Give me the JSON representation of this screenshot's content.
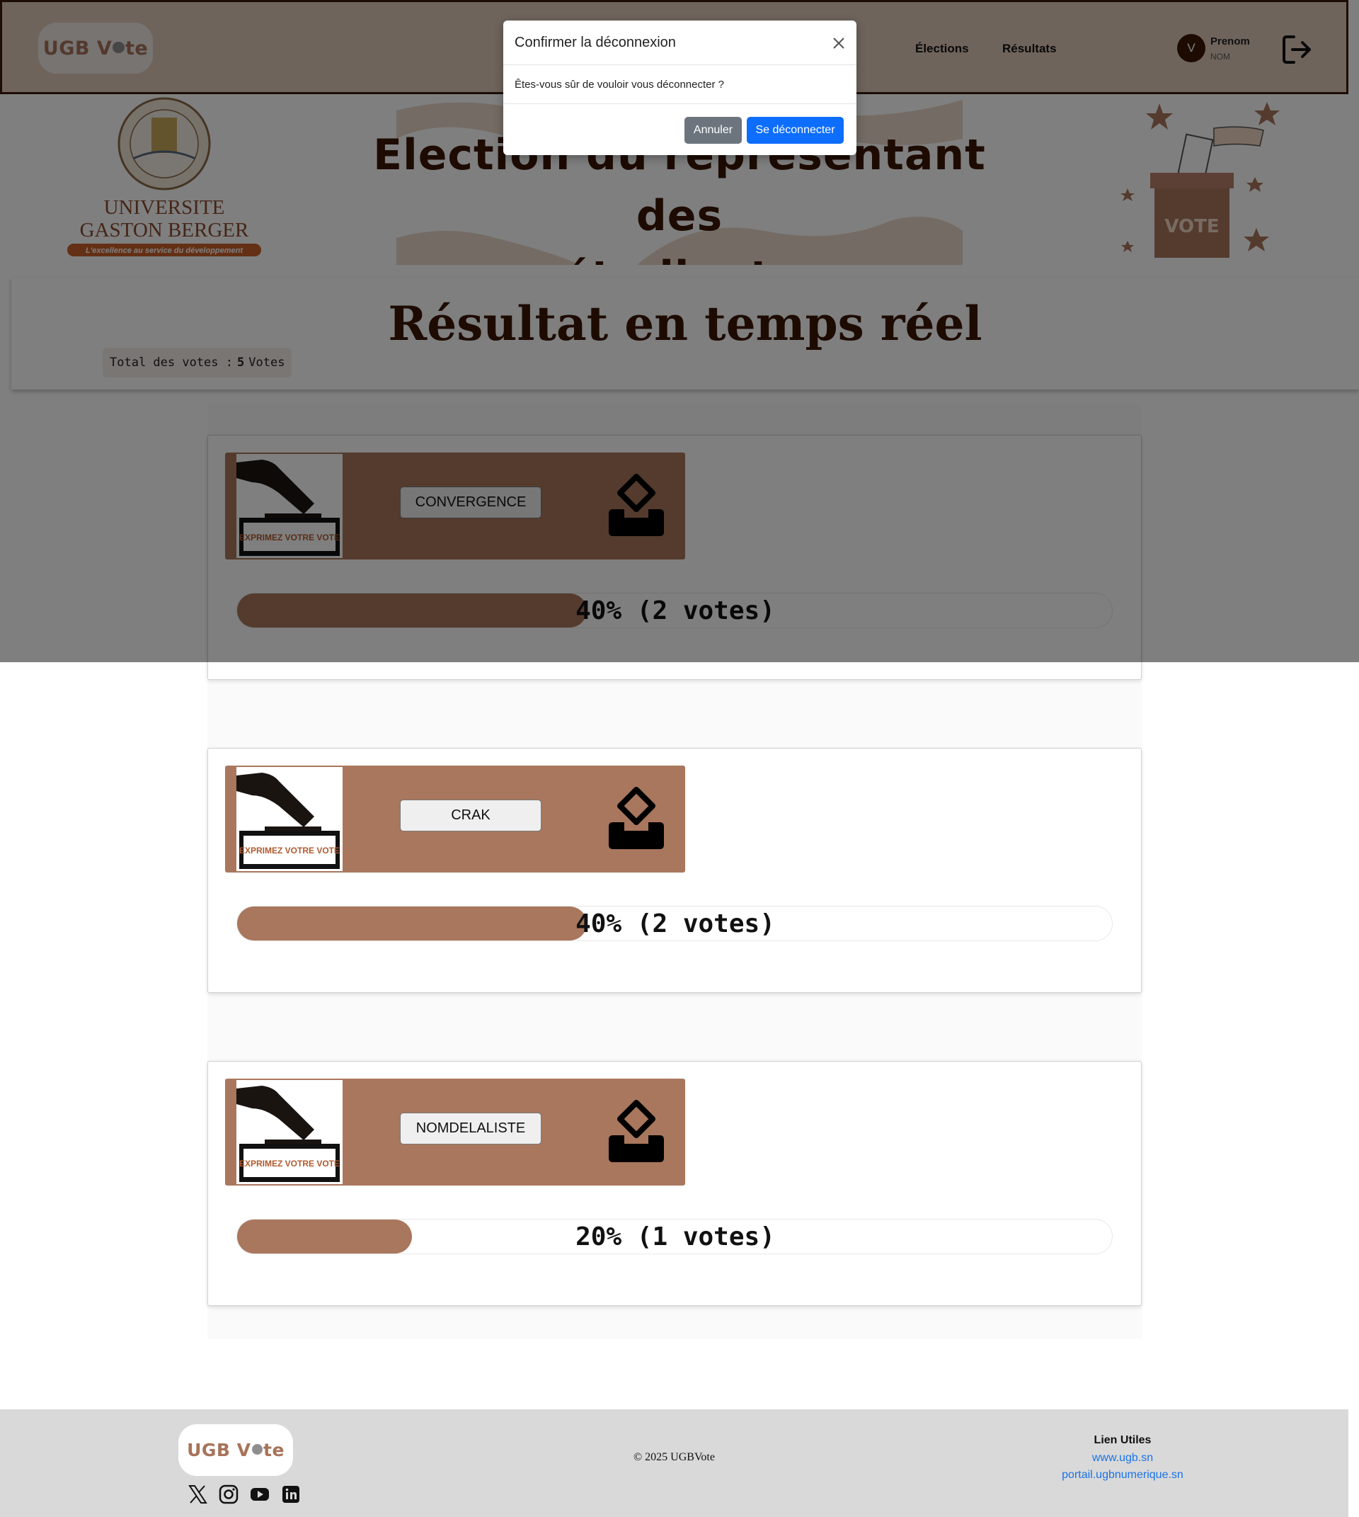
{
  "header": {
    "logo": {
      "text_left": "UGB V",
      "text_right": "te"
    },
    "nav": [
      {
        "label": "Élections"
      },
      {
        "label": "Résultats"
      }
    ],
    "user": {
      "initial": "V",
      "first_name": "Prenom",
      "last_name": "NOM"
    }
  },
  "banner": {
    "title_line1": "Election du représentant des",
    "title_line2": "étudiants",
    "university": {
      "name_line1": "UNIVERSITE",
      "name_line2": "GASTON BERGER",
      "motto": "L'excellence au service du développement",
      "seal_text": "UNIVERSITE GASTON BERGER · SAINT-LOUIS DU SENEGAL"
    },
    "vote_box_text": "VOTE"
  },
  "results": {
    "title": "Résultat en temps réel",
    "total_label": "Total des votes :",
    "total_count": "5",
    "total_unit": "Votes"
  },
  "candidates": [
    {
      "name": "CONVERGENCE",
      "image_caption": "EXPRIMEZ VOTRE VOTE",
      "percent": 40,
      "label": "40% (2 votes)"
    },
    {
      "name": "CRAK",
      "image_caption": "EXPRIMEZ VOTRE VOTE",
      "percent": 40,
      "label": "40% (2 votes)"
    },
    {
      "name": "NOMDELALISTE",
      "image_caption": "EXPRIMEZ VOTRE VOTE",
      "percent": 20,
      "label": "20% (1 votes)"
    }
  ],
  "footer": {
    "logo": {
      "text_left": "UGB V",
      "text_right": "te"
    },
    "copyright": "© 2025 UGBVote",
    "links_title": "Lien Utiles",
    "links": [
      {
        "label": "www.ugb.sn"
      },
      {
        "label": "portail.ugbnumerique.sn"
      }
    ],
    "social_icons": [
      "x-icon",
      "instagram-icon",
      "youtube-icon",
      "linkedin-icon"
    ]
  },
  "modal": {
    "title": "Confirmer la déconnexion",
    "body": "Êtes-vous sûr de vouloir vous déconnecter ?",
    "cancel_label": "Annuler",
    "confirm_label": "Se déconnecter"
  },
  "colors": {
    "brand_brown": "#a9775d",
    "dark_brown": "#3a1604",
    "primary_blue": "#0d6efd",
    "secondary_gray": "#6c757d"
  }
}
